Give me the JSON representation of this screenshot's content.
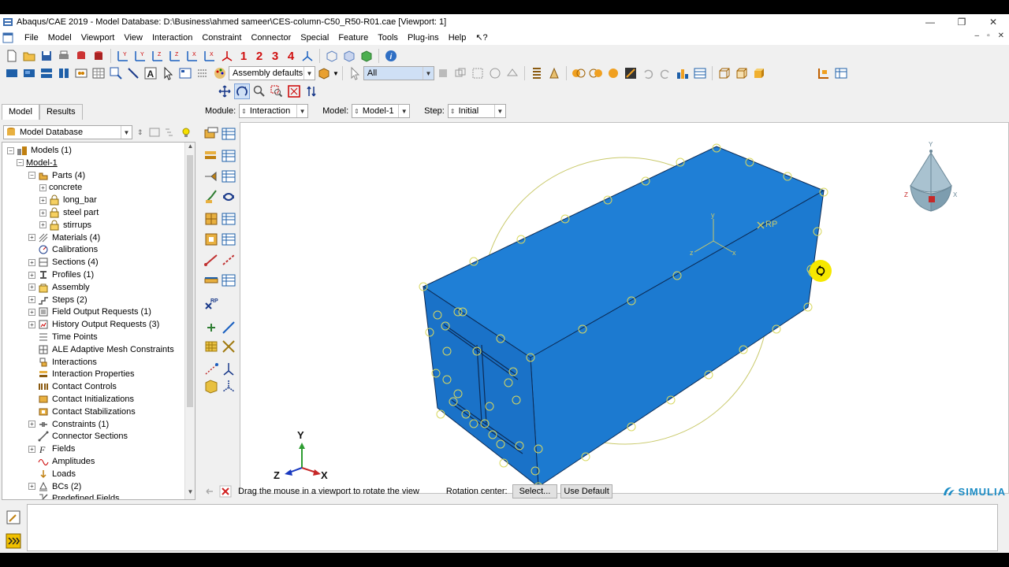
{
  "window": {
    "title": "Abaqus/CAE 2019 - Model Database: D:\\Business\\ahmed sameer\\CES-column-C50_R50-R01.cae [Viewport: 1]",
    "minimize": "—",
    "maximize": "❐",
    "close": "✕"
  },
  "menu": [
    {
      "label": "File"
    },
    {
      "label": "Model"
    },
    {
      "label": "Viewport"
    },
    {
      "label": "View"
    },
    {
      "label": "Interaction"
    },
    {
      "label": "Constraint"
    },
    {
      "label": "Connector"
    },
    {
      "label": "Special"
    },
    {
      "label": "Feature"
    },
    {
      "label": "Tools"
    },
    {
      "label": "Plug-ins"
    },
    {
      "label": "Help"
    },
    {
      "label": "↖?"
    }
  ],
  "toolbar": {
    "view_numbers": [
      "1",
      "2",
      "3",
      "4"
    ],
    "render_style": "Assembly defaults",
    "selection_filter": "All"
  },
  "left_panel": {
    "tabs": [
      "Model",
      "Results"
    ],
    "tree_source": "Model Database",
    "tree": [
      {
        "label": "Models (1)",
        "level": 0,
        "expander": "−",
        "icon": "models-icon"
      },
      {
        "label": "Model-1",
        "level": 1,
        "expander": "−",
        "icon": "",
        "underline": true
      },
      {
        "label": "Parts (4)",
        "level": 2,
        "expander": "−",
        "icon": "parts-icon"
      },
      {
        "label": "concrete",
        "level": 3,
        "expander": "+",
        "icon": ""
      },
      {
        "label": "long_bar",
        "level": 3,
        "expander": "+",
        "icon": "lock-icon"
      },
      {
        "label": "steel part",
        "level": 3,
        "expander": "+",
        "icon": "lock-icon"
      },
      {
        "label": "stirrups",
        "level": 3,
        "expander": "+",
        "icon": "lock-icon"
      },
      {
        "label": "Materials (4)",
        "level": 2,
        "expander": "+",
        "icon": "materials-icon"
      },
      {
        "label": "Calibrations",
        "level": 2,
        "expander": "",
        "icon": "calibrations-icon"
      },
      {
        "label": "Sections (4)",
        "level": 2,
        "expander": "+",
        "icon": "sections-icon"
      },
      {
        "label": "Profiles (1)",
        "level": 2,
        "expander": "+",
        "icon": "profiles-icon"
      },
      {
        "label": "Assembly",
        "level": 2,
        "expander": "+",
        "icon": "assembly-icon"
      },
      {
        "label": "Steps (2)",
        "level": 2,
        "expander": "+",
        "icon": "steps-icon"
      },
      {
        "label": "Field Output Requests (1)",
        "level": 2,
        "expander": "+",
        "icon": "field-output-icon"
      },
      {
        "label": "History Output Requests (3)",
        "level": 2,
        "expander": "+",
        "icon": "history-output-icon"
      },
      {
        "label": "Time Points",
        "level": 2,
        "expander": "",
        "icon": "time-points-icon"
      },
      {
        "label": "ALE Adaptive Mesh Constraints",
        "level": 2,
        "expander": "",
        "icon": "ale-mesh-icon"
      },
      {
        "label": "Interactions",
        "level": 2,
        "expander": "",
        "icon": "interactions-icon"
      },
      {
        "label": "Interaction Properties",
        "level": 2,
        "expander": "",
        "icon": "interaction-properties-icon"
      },
      {
        "label": "Contact Controls",
        "level": 2,
        "expander": "",
        "icon": "contact-controls-icon"
      },
      {
        "label": "Contact Initializations",
        "level": 2,
        "expander": "",
        "icon": "contact-init-icon"
      },
      {
        "label": "Contact Stabilizations",
        "level": 2,
        "expander": "",
        "icon": "contact-stab-icon"
      },
      {
        "label": "Constraints (1)",
        "level": 2,
        "expander": "+",
        "icon": "constraints-icon"
      },
      {
        "label": "Connector Sections",
        "level": 2,
        "expander": "",
        "icon": "connector-sections-icon"
      },
      {
        "label": "Fields",
        "level": 2,
        "expander": "+",
        "icon": "fields-icon"
      },
      {
        "label": "Amplitudes",
        "level": 2,
        "expander": "",
        "icon": "amplitudes-icon"
      },
      {
        "label": "Loads",
        "level": 2,
        "expander": "",
        "icon": "loads-icon"
      },
      {
        "label": "BCs (2)",
        "level": 2,
        "expander": "+",
        "icon": "bcs-icon"
      },
      {
        "label": "Predefined Fields",
        "level": 2,
        "expander": "",
        "icon": "predefined-fields-icon"
      }
    ]
  },
  "context_bar": {
    "module_label": "Module:",
    "module_value": "Interaction",
    "model_label": "Model:",
    "model_value": "Model-1",
    "step_label": "Step:",
    "step_value": "Initial"
  },
  "viewport": {
    "rp_label": "RP",
    "triad": {
      "x": "X",
      "y": "Y",
      "z": "Z"
    },
    "csys": {
      "x": "x",
      "y": "y",
      "z": "z"
    },
    "view_cube": {
      "x": "X",
      "y": "Y"
    },
    "colors": {
      "solid": "#1f7fd6",
      "solid_dark": "#1565b8",
      "solid_side": "#1a72c8",
      "edges": "#0c2b55",
      "rotation_circle": "#c9c96a",
      "cursor": "#f6e800"
    }
  },
  "prompt": {
    "text": "Drag the mouse in a viewport to rotate the view",
    "rotation_center_label": "Rotation center:",
    "select_button": "Select...",
    "default_button": "Use Default"
  },
  "brand": "SIMULIA"
}
